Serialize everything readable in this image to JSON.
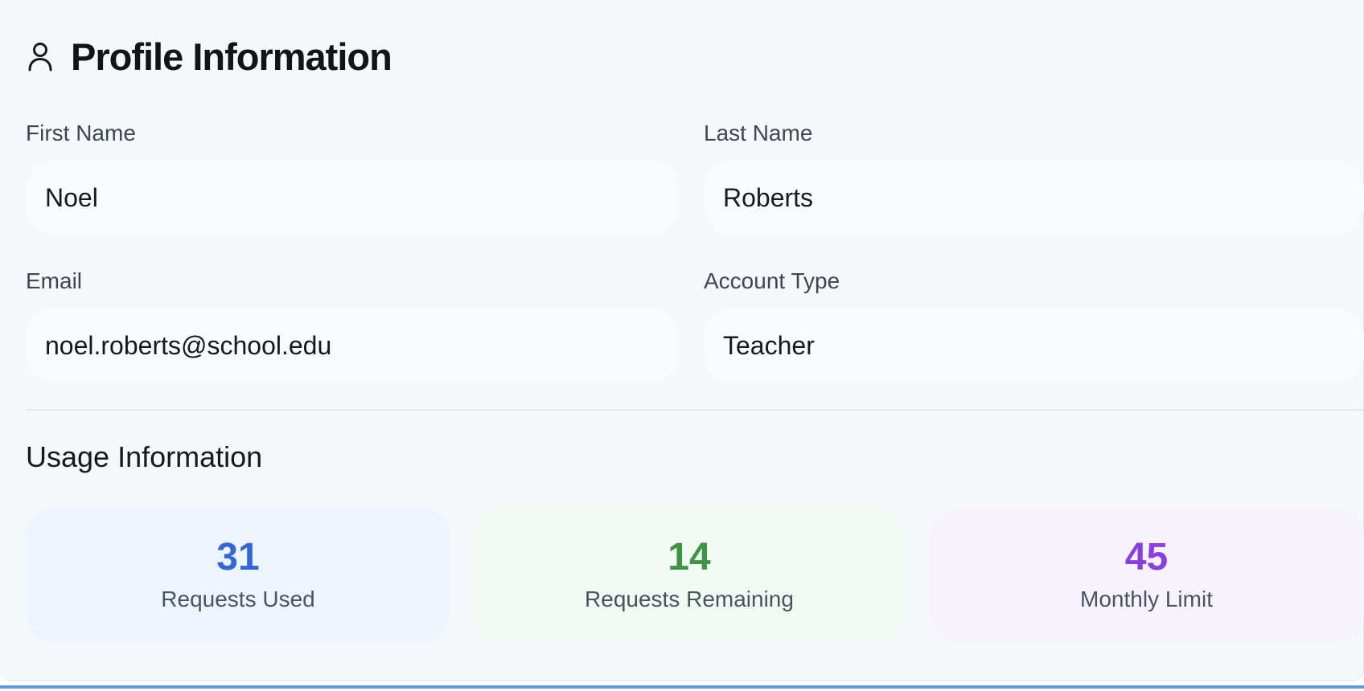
{
  "header": {
    "icon": "user-icon",
    "title": "Profile Information"
  },
  "profile": {
    "first_name": {
      "label": "First Name",
      "value": "Noel"
    },
    "last_name": {
      "label": "Last Name",
      "value": "Roberts"
    },
    "email": {
      "label": "Email",
      "value": "noel.roberts@school.edu"
    },
    "account_type": {
      "label": "Account Type",
      "value": "Teacher"
    }
  },
  "usage": {
    "title": "Usage Information",
    "stats": [
      {
        "value": "31",
        "label": "Requests Used",
        "color": "#3366d6",
        "bg": "#eef4fd"
      },
      {
        "value": "14",
        "label": "Requests Remaining",
        "color": "#3f9444",
        "bg": "#f0faf2"
      },
      {
        "value": "45",
        "label": "Monthly Limit",
        "color": "#8b3fe0",
        "bg": "#f7f3fc"
      }
    ]
  },
  "colors": {
    "card_background": "#f6f7f8",
    "bottom_accent": "#5b9be0"
  }
}
